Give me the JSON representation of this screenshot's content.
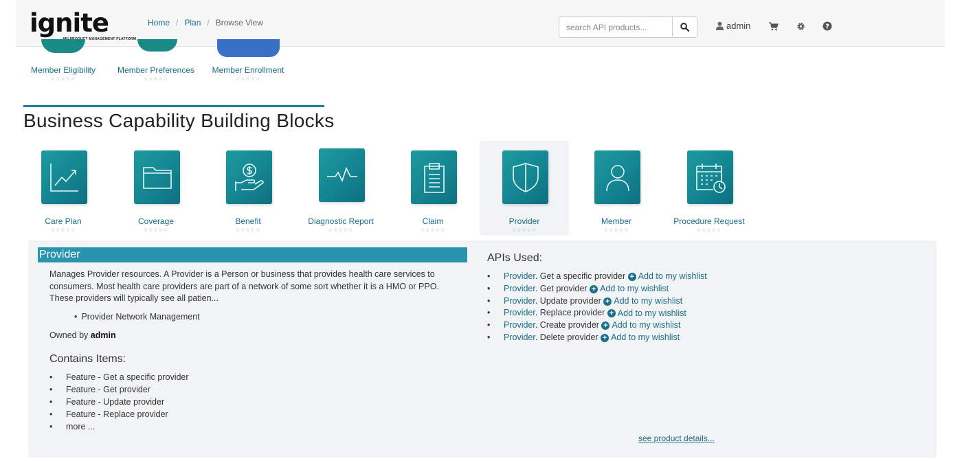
{
  "header": {
    "logo_text": "ignite",
    "logo_tagline": "API PRODUCT MANAGEMENT PLATFORM",
    "breadcrumb": [
      "Home",
      "Plan",
      "Browse View"
    ],
    "search_placeholder": "search API products...",
    "user_label": "admin",
    "icons": [
      "search-icon",
      "user-icon",
      "cart-icon",
      "gear-icon",
      "help-icon"
    ]
  },
  "top_row": [
    {
      "label": "Member Eligibility",
      "stars": "☆☆☆☆☆",
      "color": "#1a8a86"
    },
    {
      "label": "Member Preferences",
      "stars": "☆☆☆☆☆",
      "color": "#1a8a86"
    },
    {
      "label": "Member Enrollment",
      "stars": "☆☆☆☆☆",
      "color": "#3a6fc7"
    }
  ],
  "section_title": "Business Capability Building Blocks",
  "capabilities": [
    {
      "label": "Care Plan",
      "stars": "☆☆☆☆☆",
      "icon": "chart-line-icon"
    },
    {
      "label": "Coverage",
      "stars": "☆☆☆☆☆",
      "icon": "folder-icon"
    },
    {
      "label": "Benefit",
      "stars": "☆☆☆☆☆",
      "icon": "money-hand-icon"
    },
    {
      "label": "Diagnostic Report",
      "stars": "☆☆☆☆☆",
      "icon": "pulse-icon"
    },
    {
      "label": "Claim",
      "stars": "☆☆☆☆☆",
      "icon": "clipboard-icon"
    },
    {
      "label": "Provider",
      "stars": "☆☆☆☆☆",
      "icon": "shield-icon"
    },
    {
      "label": "Member",
      "stars": "☆☆☆☆☆",
      "icon": "person-icon"
    },
    {
      "label": "Procedure Request",
      "stars": "☆☆☆☆☆",
      "icon": "calendar-clock-icon"
    }
  ],
  "detail": {
    "title": "Provider",
    "description": "Manages Provider resources. A Provider is a Person or business that provides health care services to consumers. Most health care providers are part of a network of some sort whether it is a HMO or PPO. These providers will typically see all patien...",
    "tags": [
      "Provider Network Management"
    ],
    "owned_prefix": "Owned by",
    "owner": "admin",
    "contains_heading": "Contains Items:",
    "contains": [
      "Feature - Get a specific provider",
      "Feature - Get provider",
      "Feature - Update provider",
      "Feature - Replace provider",
      "more ..."
    ],
    "apis_heading": "APIs Used:",
    "apis": [
      {
        "link": "Provider",
        "text": ". Get a specific provider",
        "wishlist": "Add to my wishlist"
      },
      {
        "link": "Provider",
        "text": ". Get provider",
        "wishlist": "Add to my wishlist"
      },
      {
        "link": "Provider",
        "text": ". Update provider",
        "wishlist": "Add to my wishlist"
      },
      {
        "link": "Provider",
        "text": ". Replace provider",
        "wishlist": "Add to my wishlist"
      },
      {
        "link": "Provider",
        "text": ". Create provider",
        "wishlist": "Add to my wishlist"
      },
      {
        "link": "Provider",
        "text": ". Delete provider",
        "wishlist": "Add to my wishlist"
      }
    ],
    "details_link": "see product details..."
  }
}
